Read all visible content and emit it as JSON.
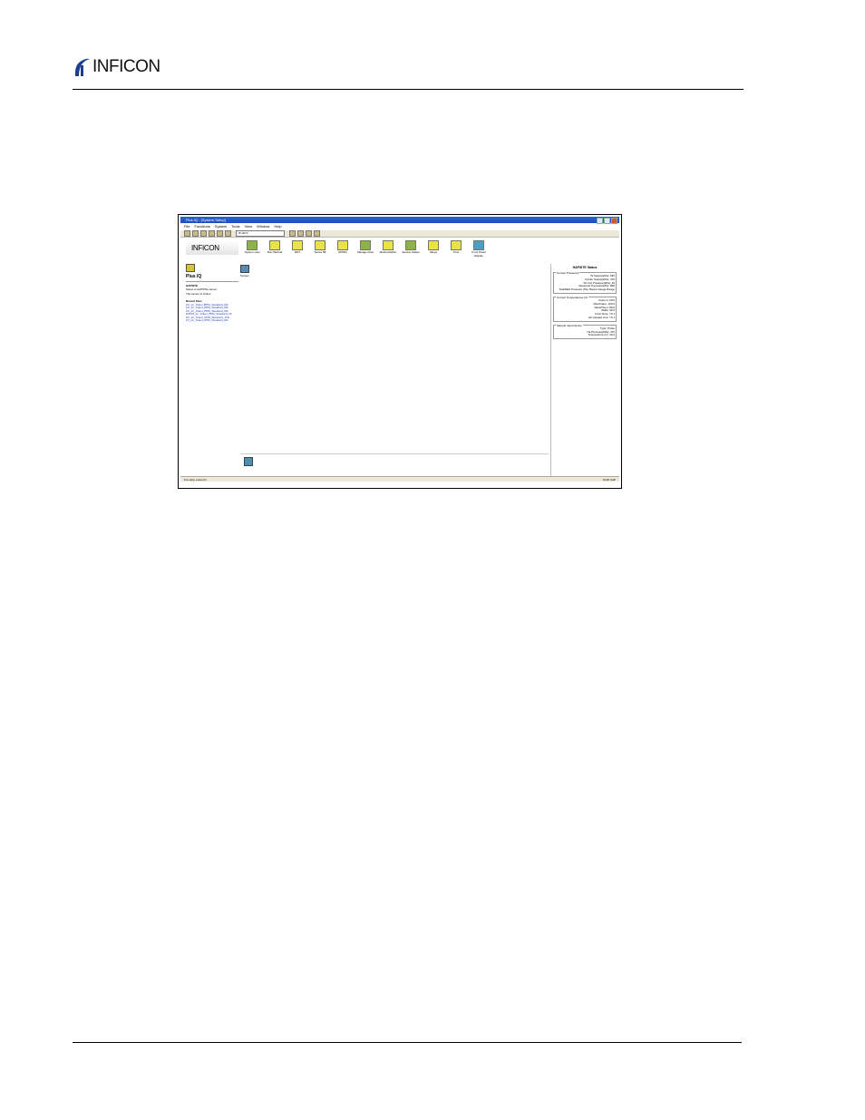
{
  "header": {
    "brand": "INFICON"
  },
  "figure": {
    "window_title": "Plus IQ - [System Setup]",
    "menu": [
      "File",
      "Functions",
      "System",
      "Tools",
      "View",
      "Window",
      "Help"
    ],
    "toolbar_combo": "IP-3074",
    "icons": [
      {
        "label": "System view",
        "icon": "system-view-icon"
      },
      {
        "label": "Run Method",
        "icon": "run-method-icon"
      },
      {
        "label": "RDT",
        "icon": "rdt-icon"
      },
      {
        "label": "Series 58",
        "icon": "series-icon"
      },
      {
        "label": "RPIRD",
        "icon": "rpird-icon"
      },
      {
        "label": "Manage Files",
        "icon": "manage-files-icon"
      },
      {
        "label": "Method Editor",
        "icon": "method-editor-icon"
      },
      {
        "label": "Service Status",
        "icon": "service-status-icon"
      },
      {
        "label": "Sifeye",
        "icon": "sifeye-icon"
      },
      {
        "label": "Tune",
        "icon": "tune-icon"
      },
      {
        "label": "Front Panel Display",
        "icon": "front-panel-icon"
      }
    ],
    "left_panel": {
      "logo": "INFICON",
      "title": "Plus IQ",
      "section": "HAPSITE",
      "lines": [
        "Select a HAPSITE sensor",
        "The sensor is Online"
      ],
      "recent_title": "Recent Files",
      "recent_files": [
        "FC_trc_Toluol_BPM_Standard_DR",
        "FC_trc_Toluol_PPM_Standard_DR",
        "FC_trc_Toluol_PPM_Standard_DR",
        "P0S78_trc_Toluol_PPM_Standard_trh",
        "PC_trc_Toluol_PPM_Standard_JTE",
        "FC_trc_Toluol_PPM_Standard_DR"
      ]
    },
    "center": {
      "system_label": "System"
    },
    "status_panel": {
      "title": "HAPSITE Status",
      "groups": [
        {
          "label": "Current Pressures",
          "rows": [
            "IS Supply(kPa): 625",
            "Carrier Supply(kPa): 470",
            "SC Col Pressure(kPa): 40",
            "Reservoir Pressure(kPa): 800",
            "TotalNEG Pressure (Pa): Below Gauge Range"
          ]
        },
        {
          "label": "Current Temperatures (C)",
          "rows": [
            "Column: 60.5",
            "Membrane: 100.0",
            "Valve/Oven: 80.0",
            "Walls: 40.0",
            "Front Door: 70.1",
            "GC Heated Line: 70.1"
          ]
        },
        {
          "label": "Sample Input Device",
          "rows": [
            "Type: Probe",
            "N2 Pressure(kPa): 470",
            "Temperature (C): 40.2"
          ]
        }
      ]
    },
    "statusbar": {
      "left": "For Help, press F1",
      "right": "NUM  CAP"
    }
  }
}
